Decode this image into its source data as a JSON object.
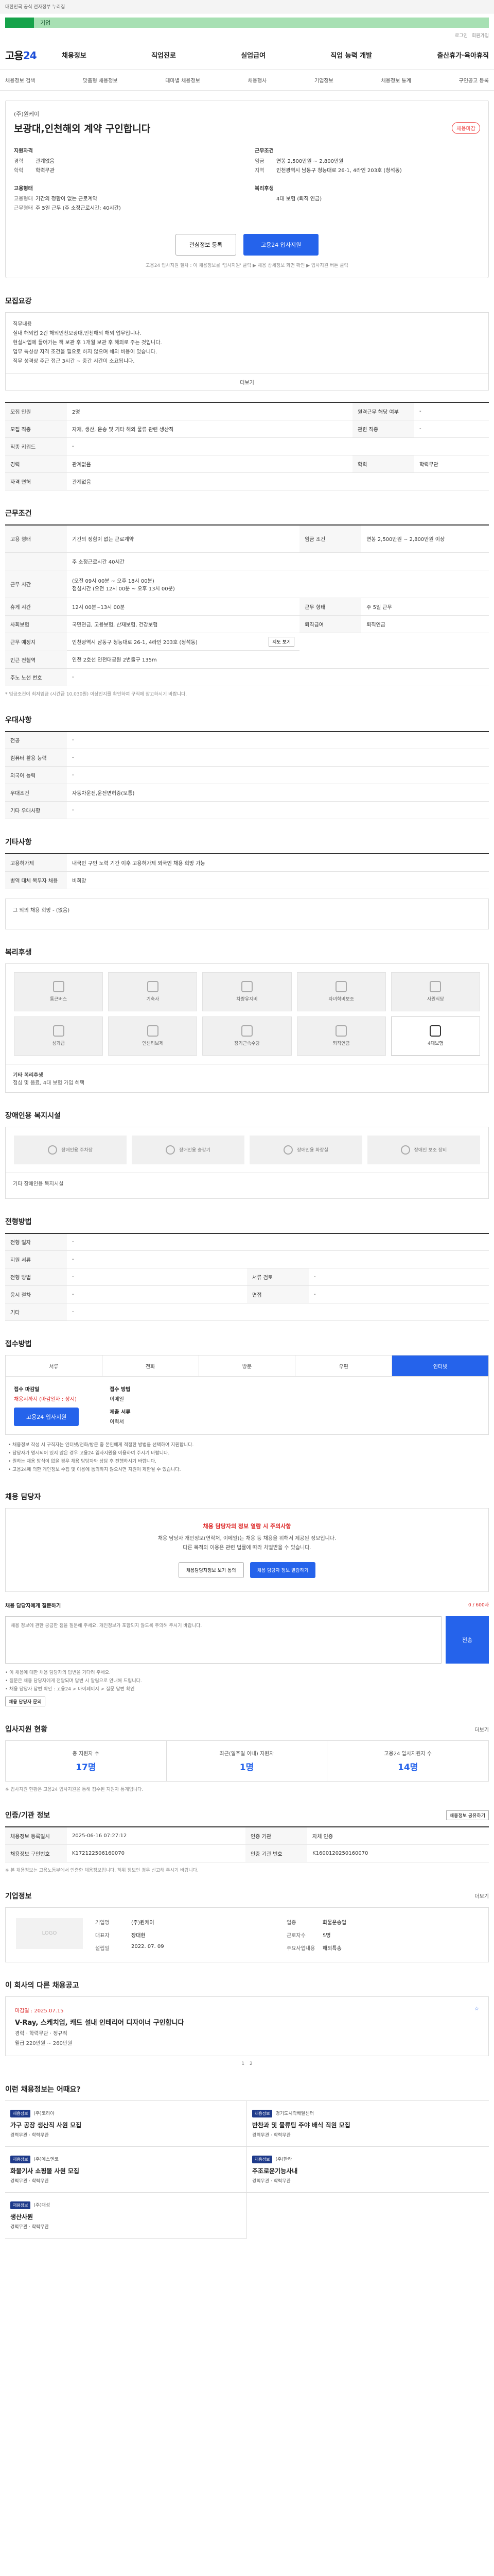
{
  "topbar": {
    "text": "대한민국 공식 전자정부 누리집"
  },
  "banner": {
    "text": "기업"
  },
  "util": {
    "login": "로그인",
    "join": "회원가입"
  },
  "logo": {
    "main": "고용",
    "num": "24"
  },
  "gnb": [
    "채용정보",
    "직업진로",
    "실업급여",
    "직업 능력 개발",
    "출산휴가·육아휴직"
  ],
  "subnav": [
    "채용정보 검색",
    "맞춤형 채용정보",
    "테마별 채용정보",
    "채용행사",
    "기업정보",
    "채용정보 통계",
    "구인공고 등록"
  ],
  "job": {
    "company": "(주)원케이",
    "title": "보광대,인천해외 계약 구인합니다",
    "dday": "채용마감",
    "left_heading": "지원자격",
    "left": [
      {
        "k": "경력",
        "v": "관계없음"
      },
      {
        "k": "학력",
        "v": "학력무관"
      }
    ],
    "employ_heading": "고용형태",
    "employ": [
      {
        "k": "고용형태",
        "v": "기간의 정함이 없는 근로계약"
      },
      {
        "k": "근무형태",
        "v": "주 5일 근무 (주 소정근로시간: 40시간)"
      }
    ],
    "right_heading": "근무조건",
    "right": [
      {
        "k": "임금",
        "v": "연봉 2,500만원 ~ 2,800만원"
      },
      {
        "k": "지역",
        "v": "인천광역시 남동구 청능대로 26-1, 4라인 203호 (청석동)"
      }
    ],
    "welfare_heading": "복리후생",
    "welfare": [
      {
        "k": "",
        "v": "4대 보험 (퇴직 연금)"
      }
    ],
    "btn_scrap": "관심정보 등록",
    "btn_apply": "고용24 입사지원",
    "note": "고용24 입사지원 절차 : 이 채용정보를 '입사지원' 클릭 ▶ 채용 상세정보 화면 확인 ▶ 입사지원 버튼 클릭"
  },
  "recruit": {
    "heading": "모집요강",
    "lines": [
      "직무내용",
      "실내 해외업 2건 해외인천보광대,인천해외 해외 업무입니다.",
      "현실사업에 들어가는 책 보관 후 1개월 보관 후 해외로 주는 것입니다.",
      "업무 특성상 자격 조건을 필요로 하지 않으며 해외 비용이 있습니다.",
      "직무 성격상 주근 접근 3시간 ~ 중간 시간이 소요됩니다."
    ],
    "more": "더보기",
    "rows": [
      {
        "k1": "모집 인원",
        "v1": "2명",
        "k2": "원격근무 해당 여부",
        "v2": "-"
      },
      {
        "k1": "모집 직종",
        "v1": "자재, 생산, 운송 및 기타 해외 물류 관련 생산직",
        "k2": "관련 직종",
        "v2": "-"
      },
      {
        "k1": "직종 키워드",
        "v1": "-",
        "k2": "",
        "v2": ""
      },
      {
        "k1": "경력",
        "v1": "관계없음",
        "k2": "학력",
        "v2": "학력무관"
      },
      {
        "k1": "자격 면허",
        "v1": "관계없음",
        "k2": "",
        "v2": ""
      }
    ]
  },
  "conditions": {
    "heading": "근무조건",
    "r1": {
      "k1": "고용 형태",
      "v1": "기간의 정함이 없는 근로계약",
      "k2": "임금 조건",
      "v2": "연봉 2,500만원 ~ 2,800만원 이상"
    },
    "r2_tag": "주 소정근로시간 40시간",
    "r3": {
      "k1": "근무 시간",
      "v1": "(오전 09시 00분 ~ 오후 18시 00분)",
      "v1b": "점심시간 (오전 12시 00분 ~ 오후 13시 00분)"
    },
    "r4": {
      "k1": "휴게 시간",
      "v1": "12시 00분~13시 00분",
      "k2": "근무 형태",
      "v2": "주 5일 근무"
    },
    "r5": {
      "k1": "사회보험",
      "v1": "국민연금, 고용보험, 산재보험, 건강보험",
      "k2": "퇴직급여",
      "v2": "퇴직연금"
    },
    "r6": {
      "k1": "근무 예정지",
      "v1": "인천광역시 남동구 청능대로 26-1, 4라인 203호 (청석동)",
      "btn": "지도 보기"
    },
    "r7": {
      "k1": "인근 전철역",
      "v1": "인천 2호선 인천대공원 2번출구 135m"
    },
    "r8": {
      "k1": "주노 노선 번호",
      "v1": "-"
    },
    "footnote": "* 임금조건이 최저임금 (시간급 10,030원) 이상인지를 확인하여 구직에 참고하시기 바랍니다."
  },
  "prefer": {
    "heading": "우대사항",
    "rows": [
      {
        "k": "전공",
        "v": "-"
      },
      {
        "k": "컴퓨터 활용 능력",
        "v": "-"
      },
      {
        "k": "외국어 능력",
        "v": "-"
      },
      {
        "k": "우대조건",
        "v": "자동차운전,운전면허증(보통)"
      },
      {
        "k": "기타 우대사항",
        "v": "-"
      }
    ]
  },
  "etc": {
    "heading": "기타사항",
    "rows": [
      {
        "k": "고용허가제",
        "v": "내국인 구인 노력 기간 이후 고용허가제 외국인 채용 희망 가능"
      },
      {
        "k": "병역 대체 복무자 채용",
        "v": "비희망"
      }
    ],
    "extra": "그 외의 채용 희망 - (없음)"
  },
  "welfare": {
    "heading": "복리후생",
    "items": [
      "통근버스",
      "기숙사",
      "차량유지비",
      "자녀학비보조",
      "사원식당",
      "성과급",
      "인센티브제",
      "장기근속수당",
      "퇴직연금",
      "4대보험"
    ],
    "note_title": "기타 복리후생",
    "note": "점심 및 음료, 4대 보험 가입 혜택"
  },
  "disability": {
    "heading": "장애인용 복지시설",
    "items": [
      "장애인용 주차장",
      "장애인용 승강기",
      "장애인용 화장실",
      "장애인 보조 장비"
    ],
    "note": "기타 장애인용 복지시설"
  },
  "selection": {
    "heading": "전형방법",
    "rows": [
      {
        "k1": "전형 일자",
        "v1": "-",
        "k2": "",
        "v2": ""
      },
      {
        "k1": "지원 서류",
        "v1": "-",
        "k2": "",
        "v2": ""
      },
      {
        "k1": "전형 방법",
        "v1": "-",
        "k2": "서류 검토",
        "v2": "-"
      },
      {
        "k1": "응시 절차",
        "v1": "-",
        "k2": "면접",
        "v2": "-"
      },
      {
        "k1": "기타",
        "v1": "-",
        "k2": "",
        "v2": ""
      }
    ]
  },
  "apply": {
    "heading": "접수방법",
    "tabs": [
      "서류",
      "전화",
      "방문",
      "우편",
      "인터넷"
    ],
    "deadline_label": "접수 마감일",
    "deadline": "채용시까지 (마감일자 : 상시)",
    "btn": "고용24 입사지원",
    "doc_label": "접수 방법",
    "doc": "이메일",
    "note_label": "제출 서류",
    "note": "이력서",
    "bullets": [
      "• 채용정보 작성 시 구직자는 인터넷/전화/방문 중 본인에게 적절한 방법을 선택하여 지원합니다.",
      "• 담당자가 명시되어 있지 않은 경우 고용24 입사지원을 이용하여 주시기 바랍니다.",
      "• 원하는 채용 방식이 없을 경우 채용 담당자와 상담 후 진행하시기 바랍니다.",
      "• 고용24에 의한 개인정보 수집 및 이용에 동의하지 않으시면 지원이 제한될 수 있습니다."
    ]
  },
  "manager": {
    "heading": "채용 담당자",
    "warn": "채용 담당자의 정보 열람 시 주의사항",
    "lines": [
      "채용 담당자 개인정보(연락처, 이메일)는 채용 등 채용을 위해서 제공된 정보입니다.",
      "다른 목적의 이용은 관련 법률에 따라 처벌받을 수 있습니다."
    ],
    "btn1": "채용담당자정보 보기 동의",
    "btn2": "채용 담당자 정보 열람하기",
    "q_title": "채용 담당자에게 질문하기",
    "q_count": "0 / 600자",
    "q_placeholder": "채용 정보에 관한 궁금한 점을 질문해 주세요. 개인정보가 포함되지 않도록 주의해 주시기 바랍니다.",
    "q_send": "전송",
    "q_notes": [
      "• 이 채용에 대한 채용 담당자의 답변을 기다려 주세요.",
      "• 질문은 채용 담당자에게 전달되며 답변 시 알림으로 안내해 드립니다.",
      "• 채용 담당자 답변 확인 : 고용24 > 마이페이지 > 질문 답변 확인"
    ],
    "q_btn": "채용 담당자 문의"
  },
  "stats": {
    "heading": "입사지원 현황",
    "more": "더보기",
    "items": [
      {
        "label": "총 지원자 수",
        "value": "17명"
      },
      {
        "label": "최근(일주일 이내) 지원자",
        "value": "1명"
      },
      {
        "label": "고용24 입사지원자 수",
        "value": "14명"
      }
    ],
    "note": "※ 입사지원 현황은 고용24 입사지원을 통해 접수된 지원자 통계입니다."
  },
  "info": {
    "heading": "인증/기관 정보",
    "btn": "채용정보 공유하기",
    "r1": {
      "k1": "채용정보 등록일시",
      "v1": "2025-06-16 07:27:12",
      "k2": "인증 기관",
      "v2": "자체 인증"
    },
    "r2": {
      "k1": "채용정보 구인번호",
      "v1": "K172122506160070",
      "k2": "인증 기관 번호",
      "v2": "K1600120250160070"
    },
    "note": "※ 본 채용정보는 고용노동부에서 인증한 채용정보입니다. 허위 정보인 경우 신고해 주시기 바랍니다."
  },
  "company": {
    "heading": "기업정보",
    "more": "더보기",
    "logo": "LOGO",
    "rows": [
      {
        "k": "기업명",
        "v": "(주)원케이"
      },
      {
        "k": "업종",
        "v": "화물운송업"
      },
      {
        "k": "대표자",
        "v": "장대현"
      },
      {
        "k": "근로자수",
        "v": "5명"
      },
      {
        "k": "설립일",
        "v": "2022. 07. 09"
      },
      {
        "k": "주요사업내용",
        "v": "해외특송"
      }
    ]
  },
  "other_jobs": {
    "heading": "이 회사의 다른 채용공고",
    "date": "마감일 : 2025.07.15",
    "title": "V-Ray, 스케치업, 캐드 설내 인테리어 디자이너 구인합니다",
    "meta1": "경력 · 학력무관 · 정규직",
    "meta2": "월급 220만원 ~ 260만원",
    "pages": [
      "1",
      "2"
    ]
  },
  "recommend": {
    "heading": "이런 채용정보는 어때요?",
    "items": [
      {
        "tag": "채용정보",
        "co": "(주)코리아",
        "title": "가구 공장 생산직 사원 모집",
        "meta": "경력무관 · 학력무관"
      },
      {
        "tag": "채용정보",
        "co": "경기도시락배달센터",
        "title": "반찬과 및 물류팀 주야 배식 직원 모집",
        "meta": "경력무관 · 학력무관"
      },
      {
        "tag": "채용정보",
        "co": "(주)에스엔코",
        "title": "화물기사 쇼핑몰 사원 모집",
        "meta": "경력무관 · 학력무관"
      },
      {
        "tag": "채용정보",
        "co": "(주)한라",
        "title": "주조로운기능사내",
        "meta": "경력무관 · 학력무관"
      },
      {
        "tag": "채용정보",
        "co": "(주)대성",
        "title": "생산사원",
        "meta": "경력무관 · 학력무관"
      }
    ]
  }
}
